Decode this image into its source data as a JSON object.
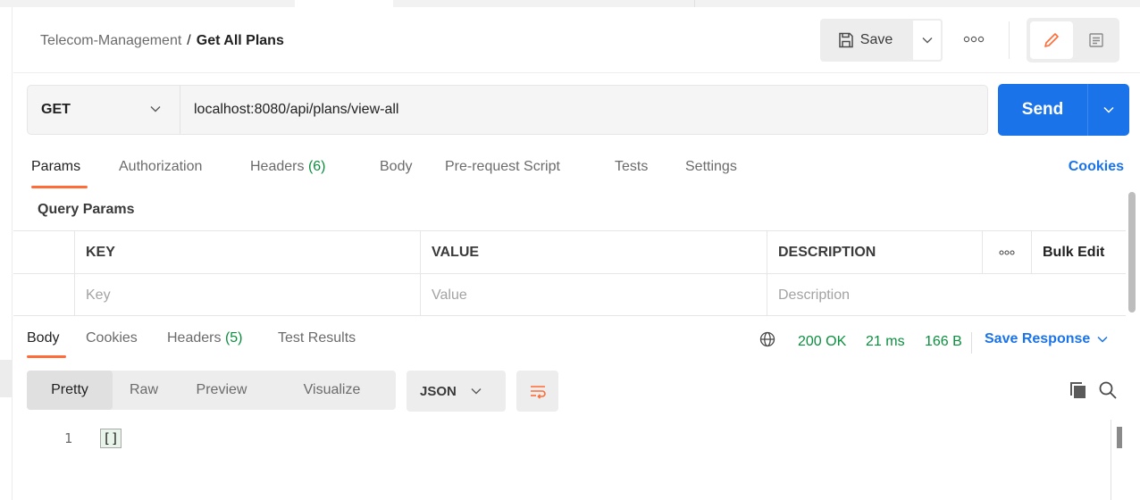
{
  "header": {
    "collection": "Telecom-Management",
    "separator": "/",
    "request_name": "Get All Plans",
    "save_label": "Save"
  },
  "request": {
    "method": "GET",
    "url": "localhost:8080/api/plans/view-all",
    "send_label": "Send"
  },
  "request_tabs": [
    {
      "label": "Params",
      "count": ""
    },
    {
      "label": "Authorization",
      "count": ""
    },
    {
      "label": "Headers",
      "count": "(6)"
    },
    {
      "label": "Body",
      "count": ""
    },
    {
      "label": "Pre-request Script",
      "count": ""
    },
    {
      "label": "Tests",
      "count": ""
    },
    {
      "label": "Settings",
      "count": ""
    }
  ],
  "cookies_label": "Cookies",
  "query_params": {
    "title": "Query Params",
    "columns": [
      "KEY",
      "VALUE",
      "DESCRIPTION"
    ],
    "more": "ooo",
    "bulk_edit": "Bulk Edit",
    "placeholders": [
      "Key",
      "Value",
      "Description"
    ]
  },
  "response": {
    "tabs": [
      {
        "label": "Body",
        "count": ""
      },
      {
        "label": "Cookies",
        "count": ""
      },
      {
        "label": "Headers",
        "count": "(5)"
      },
      {
        "label": "Test Results",
        "count": ""
      }
    ],
    "status": "200 OK",
    "time": "21 ms",
    "size": "166 B",
    "save_response": "Save Response",
    "views": [
      "Pretty",
      "Raw",
      "Preview",
      "Visualize"
    ],
    "format": "JSON",
    "line_number": "1",
    "body": "[]"
  },
  "colors": {
    "accent": "#1a73e8",
    "tab_underline": "#ff6c37",
    "success": "#0b8f3f"
  },
  "icons": [
    "save-icon",
    "chevron-down-icon",
    "more-icon",
    "pencil-icon",
    "comment-icon",
    "globe-icon",
    "wrap-lines-icon",
    "copy-icon",
    "search-icon"
  ]
}
